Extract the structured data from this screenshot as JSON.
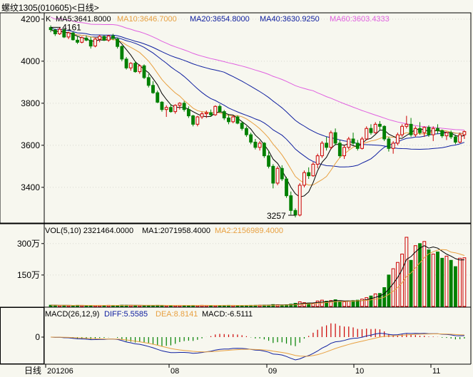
{
  "window": {
    "title": "螺纹1305(010605)<日线>"
  },
  "colors": {
    "bg": "#f7f7ef",
    "axis": "#000000",
    "grid": "#d8d8d0",
    "up": "#cc0000",
    "down": "#008000",
    "ma5": "#000000",
    "ma10": "#e8a040",
    "ma20": "#1020a0",
    "ma40": "#1020a0",
    "ma60": "#e060e0",
    "vol_ma1": "#000000",
    "vol_ma2": "#e8a040",
    "diff": "#1020a0",
    "dea": "#e8a040"
  },
  "price_panel": {
    "prefix": "K",
    "ma_labels": [
      {
        "name": "MA5",
        "text": "MA5:3641.8000",
        "color": "#000000"
      },
      {
        "name": "MA10",
        "text": "MA10:3646.7000",
        "color": "#e8a040"
      },
      {
        "name": "MA20",
        "text": "MA20:3654.8000",
        "color": "#1020a0"
      },
      {
        "name": "MA40",
        "text": "MA40:3630.9250",
        "color": "#1020a0"
      },
      {
        "name": "MA60",
        "text": "MA60:3603.4333",
        "color": "#e060e0"
      }
    ],
    "high_label": "4161",
    "low_label": "3257"
  },
  "volume_panel": {
    "title": "VOL(5,10) 2321464.0000",
    "ma1": "MA1:2071958.4000",
    "ma2": "MA2:2156989.4000"
  },
  "macd_panel": {
    "title": "MACD(26,12,9)",
    "diff": "DIFF:5.5585",
    "dea": "DEA:8.8141",
    "macd": "MACD:-6.5111"
  },
  "footer": {
    "period": "日线"
  },
  "chart_data": [
    {
      "type": "candlestick",
      "title": "螺纹1305(010605)<日线>",
      "ylim": [
        3230,
        4230
      ],
      "y_ticks": [
        3400,
        3600,
        3800,
        4000,
        4200
      ],
      "x_ticks": [
        "201206",
        "08",
        "09",
        "10",
        "11"
      ],
      "grid": true,
      "ohlc": [
        [
          4160,
          4170,
          4138,
          4150
        ],
        [
          4148,
          4155,
          4120,
          4130
        ],
        [
          4130,
          4160,
          4125,
          4152
        ],
        [
          4150,
          4152,
          4110,
          4115
        ],
        [
          4115,
          4140,
          4105,
          4135
        ],
        [
          4134,
          4140,
          4098,
          4102
        ],
        [
          4100,
          4120,
          4082,
          4090
        ],
        [
          4090,
          4118,
          4085,
          4112
        ],
        [
          4110,
          4122,
          4095,
          4100
        ],
        [
          4100,
          4115,
          4060,
          4072
        ],
        [
          4072,
          4110,
          4066,
          4105
        ],
        [
          4104,
          4125,
          4090,
          4118
        ],
        [
          4118,
          4122,
          4096,
          4100
        ],
        [
          4100,
          4125,
          4092,
          4120
        ],
        [
          4120,
          4130,
          4100,
          4108
        ],
        [
          4105,
          4112,
          4060,
          4070
        ],
        [
          4070,
          4075,
          4000,
          4010
        ],
        [
          4010,
          4020,
          3960,
          3968
        ],
        [
          3968,
          3995,
          3955,
          3990
        ],
        [
          3990,
          4000,
          3945,
          3950
        ],
        [
          3950,
          3985,
          3940,
          3978
        ],
        [
          3978,
          3985,
          3915,
          3922
        ],
        [
          3922,
          3940,
          3875,
          3885
        ],
        [
          3885,
          3905,
          3845,
          3850
        ],
        [
          3850,
          3860,
          3800,
          3805
        ],
        [
          3805,
          3810,
          3760,
          3770
        ],
        [
          3770,
          3790,
          3735,
          3780
        ],
        [
          3780,
          3795,
          3755,
          3760
        ],
        [
          3760,
          3795,
          3750,
          3790
        ],
        [
          3790,
          3805,
          3770,
          3800
        ],
        [
          3800,
          3810,
          3760,
          3770
        ],
        [
          3770,
          3785,
          3730,
          3740
        ],
        [
          3740,
          3745,
          3690,
          3700
        ],
        [
          3700,
          3740,
          3690,
          3735
        ],
        [
          3735,
          3760,
          3725,
          3750
        ],
        [
          3750,
          3765,
          3730,
          3755
        ],
        [
          3755,
          3770,
          3735,
          3745
        ],
        [
          3745,
          3790,
          3740,
          3785
        ],
        [
          3785,
          3795,
          3755,
          3760
        ],
        [
          3760,
          3768,
          3720,
          3730
        ],
        [
          3730,
          3745,
          3700,
          3712
        ],
        [
          3712,
          3740,
          3705,
          3735
        ],
        [
          3735,
          3742,
          3700,
          3705
        ],
        [
          3705,
          3715,
          3670,
          3680
        ],
        [
          3680,
          3690,
          3640,
          3650
        ],
        [
          3650,
          3660,
          3605,
          3615
        ],
        [
          3615,
          3630,
          3580,
          3590
        ],
        [
          3590,
          3620,
          3575,
          3610
        ],
        [
          3610,
          3615,
          3540,
          3550
        ],
        [
          3550,
          3575,
          3490,
          3500
        ],
        [
          3500,
          3510,
          3395,
          3420
        ],
        [
          3420,
          3500,
          3410,
          3490
        ],
        [
          3490,
          3505,
          3430,
          3440
        ],
        [
          3440,
          3450,
          3350,
          3360
        ],
        [
          3360,
          3380,
          3270,
          3290
        ],
        [
          3290,
          3300,
          3257,
          3268
        ],
        [
          3268,
          3420,
          3262,
          3410
        ],
        [
          3410,
          3480,
          3400,
          3470
        ],
        [
          3470,
          3495,
          3440,
          3455
        ],
        [
          3455,
          3520,
          3450,
          3510
        ],
        [
          3510,
          3560,
          3490,
          3550
        ],
        [
          3550,
          3620,
          3540,
          3610
        ],
        [
          3610,
          3640,
          3575,
          3590
        ],
        [
          3590,
          3670,
          3580,
          3660
        ],
        [
          3660,
          3680,
          3600,
          3610
        ],
        [
          3610,
          3625,
          3540,
          3550
        ],
        [
          3550,
          3600,
          3535,
          3590
        ],
        [
          3590,
          3640,
          3580,
          3630
        ],
        [
          3630,
          3660,
          3600,
          3610
        ],
        [
          3610,
          3625,
          3575,
          3585
        ],
        [
          3585,
          3640,
          3580,
          3630
        ],
        [
          3630,
          3690,
          3625,
          3680
        ],
        [
          3680,
          3700,
          3650,
          3660
        ],
        [
          3660,
          3710,
          3655,
          3700
        ],
        [
          3700,
          3715,
          3670,
          3690
        ],
        [
          3690,
          3695,
          3620,
          3630
        ],
        [
          3630,
          3640,
          3570,
          3585
        ],
        [
          3585,
          3620,
          3560,
          3610
        ],
        [
          3610,
          3660,
          3600,
          3650
        ],
        [
          3650,
          3700,
          3640,
          3690
        ],
        [
          3690,
          3740,
          3680,
          3700
        ],
        [
          3700,
          3730,
          3640,
          3650
        ],
        [
          3650,
          3690,
          3640,
          3680
        ],
        [
          3680,
          3710,
          3650,
          3660
        ],
        [
          3660,
          3690,
          3640,
          3685
        ],
        [
          3685,
          3695,
          3640,
          3650
        ],
        [
          3650,
          3690,
          3620,
          3680
        ],
        [
          3680,
          3700,
          3655,
          3670
        ],
        [
          3670,
          3675,
          3635,
          3645
        ],
        [
          3645,
          3665,
          3625,
          3660
        ],
        [
          3660,
          3670,
          3630,
          3640
        ],
        [
          3640,
          3650,
          3605,
          3615
        ],
        [
          3615,
          3660,
          3610,
          3650
        ],
        [
          3650,
          3670,
          3630,
          3665
        ]
      ],
      "ma_values": {
        "MA5": 3641.8,
        "MA10": 3646.7,
        "MA20": 3654.8,
        "MA40": 3630.925,
        "MA60": 3603.4333
      },
      "annotations": [
        {
          "text": "4161",
          "value": 4161
        },
        {
          "text": "3257",
          "value": 3257
        }
      ]
    },
    {
      "type": "bar",
      "title": "VOL(5,10)",
      "unit": "万",
      "y_ticks": [
        "150万",
        "300万"
      ],
      "ylim": [
        0,
        3400000
      ],
      "values": [
        60000,
        55000,
        50000,
        52000,
        48000,
        50000,
        55000,
        52000,
        50000,
        48000,
        50000,
        52000,
        50000,
        55000,
        52000,
        50000,
        60000,
        58000,
        55000,
        52000,
        50000,
        48000,
        52000,
        50000,
        55000,
        52000,
        50000,
        48000,
        50000,
        52000,
        50000,
        48000,
        52000,
        50000,
        55000,
        52000,
        50000,
        48000,
        50000,
        52000,
        55000,
        52000,
        50000,
        48000,
        52000,
        55000,
        58000,
        60000,
        62000,
        65000,
        90000,
        80000,
        70000,
        85000,
        110000,
        150000,
        220000,
        180000,
        160000,
        140000,
        260000,
        300000,
        250000,
        280000,
        320000,
        240000,
        220000,
        260000,
        280000,
        300000,
        350000,
        420000,
        500000,
        600000,
        620000,
        900000,
        1500000,
        1800000,
        2100000,
        2500000,
        3300000,
        2200000,
        2900000,
        3000000,
        3100000,
        2700000,
        2500000,
        2600000,
        2300000,
        2400000,
        2200000,
        1900000,
        2300000,
        2321464
      ],
      "last_value": 2321464,
      "ma1": 2071958.4,
      "ma2": 2156989.4
    },
    {
      "type": "bar+line",
      "title": "MACD(26,12,9)",
      "y_ticks": [
        0
      ],
      "last": {
        "DIFF": 5.5585,
        "DEA": 8.8141,
        "MACD": -6.5111
      }
    }
  ]
}
